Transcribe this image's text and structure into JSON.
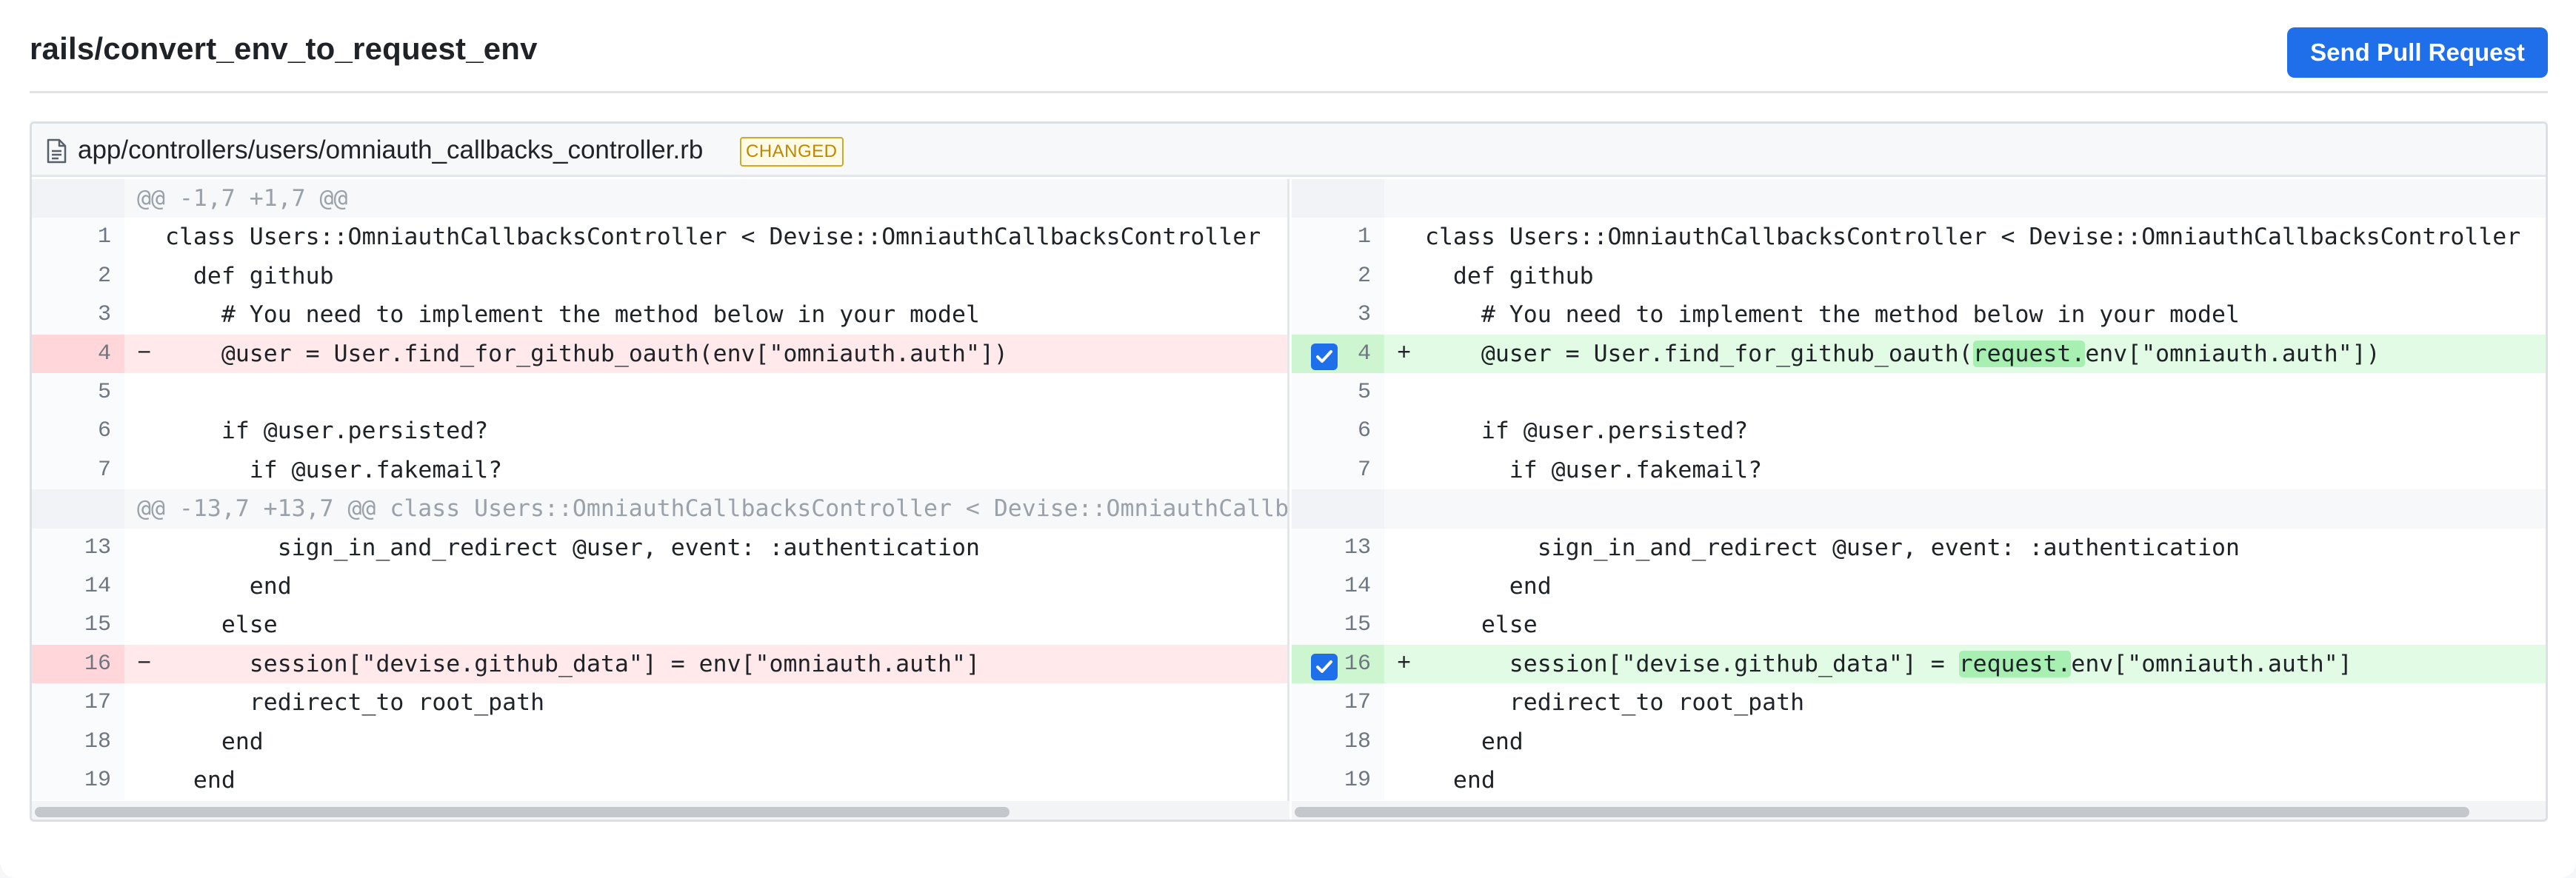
{
  "header": {
    "branch": "rails/convert_env_to_request_env",
    "send_label": "Send Pull Request"
  },
  "file": {
    "path": "app/controllers/users/omniauth_callbacks_controller.rb",
    "badge": "CHANGED",
    "icon": "file-icon"
  },
  "left_rows": [
    {
      "type": "hunk",
      "num": "",
      "sign": "",
      "text": "@@ -1,7 +1,7 @@"
    },
    {
      "type": "ctx",
      "num": "1",
      "sign": "",
      "text": "class Users::OmniauthCallbacksController < Devise::OmniauthCallbacksController"
    },
    {
      "type": "ctx",
      "num": "2",
      "sign": "",
      "text": "  def github"
    },
    {
      "type": "ctx",
      "num": "3",
      "sign": "",
      "text": "    # You need to implement the method below in your model"
    },
    {
      "type": "del",
      "num": "4",
      "sign": "−",
      "text": "    @user = User.find_for_github_oauth(env[\"omniauth.auth\"])"
    },
    {
      "type": "ctx",
      "num": "5",
      "sign": "",
      "text": ""
    },
    {
      "type": "ctx",
      "num": "6",
      "sign": "",
      "text": "    if @user.persisted?"
    },
    {
      "type": "ctx",
      "num": "7",
      "sign": "",
      "text": "      if @user.fakemail?"
    },
    {
      "type": "hunk",
      "num": "",
      "sign": "",
      "text": "@@ -13,7 +13,7 @@ class Users::OmniauthCallbacksController < Devise::OmniauthCallba"
    },
    {
      "type": "ctx",
      "num": "13",
      "sign": "",
      "text": "        sign_in_and_redirect @user, event: :authentication"
    },
    {
      "type": "ctx",
      "num": "14",
      "sign": "",
      "text": "      end"
    },
    {
      "type": "ctx",
      "num": "15",
      "sign": "",
      "text": "    else"
    },
    {
      "type": "del",
      "num": "16",
      "sign": "−",
      "text": "      session[\"devise.github_data\"] = env[\"omniauth.auth\"]"
    },
    {
      "type": "ctx",
      "num": "17",
      "sign": "",
      "text": "      redirect_to root_path"
    },
    {
      "type": "ctx",
      "num": "18",
      "sign": "",
      "text": "    end"
    },
    {
      "type": "ctx",
      "num": "19",
      "sign": "",
      "text": "  end"
    }
  ],
  "right_rows": [
    {
      "type": "hunk",
      "num": "",
      "sign": "",
      "pre": "",
      "hl": "",
      "post": ""
    },
    {
      "type": "ctx",
      "num": "1",
      "sign": "",
      "pre": "class Users::OmniauthCallbacksController < Devise::OmniauthCallbacksController",
      "hl": "",
      "post": ""
    },
    {
      "type": "ctx",
      "num": "2",
      "sign": "",
      "pre": "  def github",
      "hl": "",
      "post": ""
    },
    {
      "type": "ctx",
      "num": "3",
      "sign": "",
      "pre": "    # You need to implement the method below in your model",
      "hl": "",
      "post": ""
    },
    {
      "type": "add",
      "num": "4",
      "sign": "+",
      "pre": "    @user = User.find_for_github_oauth(",
      "hl": "request.",
      "post": "env[\"omniauth.auth\"])",
      "checked": true
    },
    {
      "type": "ctx",
      "num": "5",
      "sign": "",
      "pre": "",
      "hl": "",
      "post": ""
    },
    {
      "type": "ctx",
      "num": "6",
      "sign": "",
      "pre": "    if @user.persisted?",
      "hl": "",
      "post": ""
    },
    {
      "type": "ctx",
      "num": "7",
      "sign": "",
      "pre": "      if @user.fakemail?",
      "hl": "",
      "post": ""
    },
    {
      "type": "hunk",
      "num": "",
      "sign": "",
      "pre": "",
      "hl": "",
      "post": ""
    },
    {
      "type": "ctx",
      "num": "13",
      "sign": "",
      "pre": "        sign_in_and_redirect @user, event: :authentication",
      "hl": "",
      "post": ""
    },
    {
      "type": "ctx",
      "num": "14",
      "sign": "",
      "pre": "      end",
      "hl": "",
      "post": ""
    },
    {
      "type": "ctx",
      "num": "15",
      "sign": "",
      "pre": "    else",
      "hl": "",
      "post": ""
    },
    {
      "type": "add",
      "num": "16",
      "sign": "+",
      "pre": "      session[\"devise.github_data\"] = ",
      "hl": "request.",
      "post": "env[\"omniauth.auth\"]",
      "checked": true
    },
    {
      "type": "ctx",
      "num": "17",
      "sign": "",
      "pre": "      redirect_to root_path",
      "hl": "",
      "post": ""
    },
    {
      "type": "ctx",
      "num": "18",
      "sign": "",
      "pre": "    end",
      "hl": "",
      "post": ""
    },
    {
      "type": "ctx",
      "num": "19",
      "sign": "",
      "pre": "  end",
      "hl": "",
      "post": ""
    }
  ],
  "colors": {
    "accent": "#1f6feb",
    "deleted_bg": "#ffe9eb",
    "added_bg": "#e2fbe4",
    "added_highlight": "#a8f0b2",
    "badge": "#bf8700"
  }
}
